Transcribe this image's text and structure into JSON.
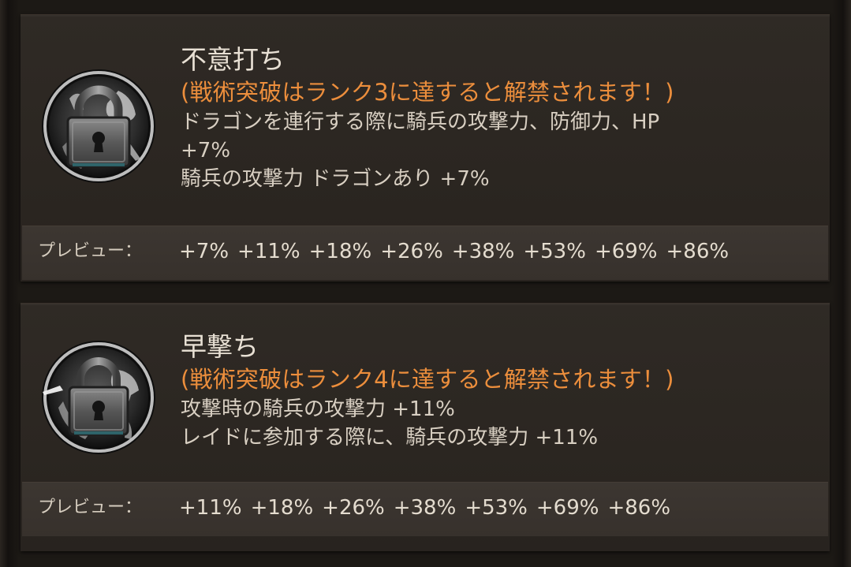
{
  "skills": [
    {
      "title": "不意打ち",
      "unlock": "(戦術突破はランク3に達すると解禁されます！)",
      "desc": [
        "ドラゴンを連行する際に騎兵の攻撃力、防御力、HP",
        "+7%",
        "騎兵の攻撃力 ドラゴンあり +7%"
      ],
      "icon": "locked-cavalry-icon",
      "preview_label": "プレビュー：",
      "preview_values": [
        "+7%",
        "+11%",
        "+18%",
        "+26%",
        "+38%",
        "+53%",
        "+69%",
        "+86%"
      ]
    },
    {
      "title": "早撃ち",
      "unlock": "(戦術突破はランク4に達すると解禁されます！)",
      "desc": [
        "攻撃時の騎兵の攻撃力 +11%",
        "レイドに参加する際に、騎兵の攻撃力 +11%"
      ],
      "icon": "locked-cavalry-charge-icon",
      "preview_label": "プレビュー：",
      "preview_values": [
        "+11%",
        "+18%",
        "+26%",
        "+38%",
        "+53%",
        "+69%",
        "+86%"
      ]
    }
  ],
  "colors": {
    "unlock_text": "#ec8e3c",
    "title_text": "#e8e0d4",
    "body_text": "#d8cfc2",
    "card_bg": "#2d2823",
    "preview_bg": "#3a342f"
  }
}
